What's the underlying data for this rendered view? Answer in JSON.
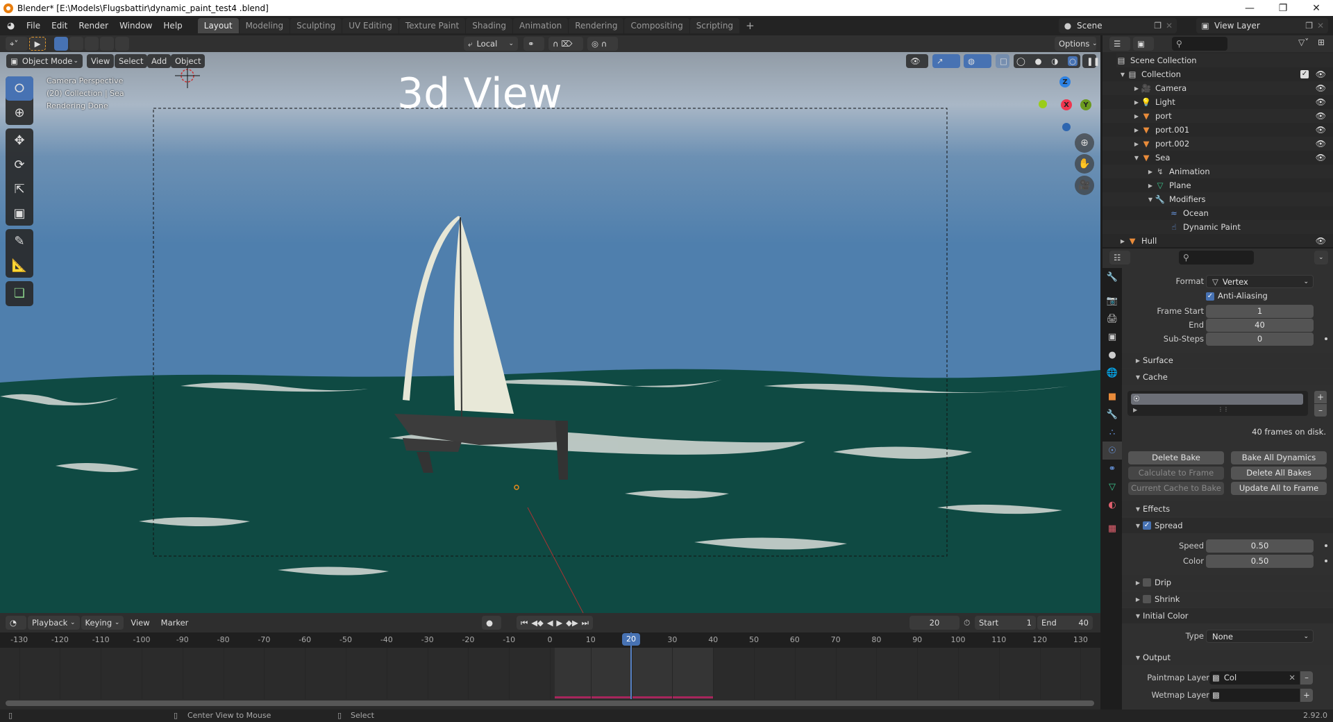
{
  "window": {
    "title": "Blender* [E:\\Models\\Flugsbattir\\dynamic_paint_test4 .blend]",
    "controls": [
      "minimize",
      "maximize",
      "close"
    ]
  },
  "menubar": {
    "menus": [
      "File",
      "Edit",
      "Render",
      "Window",
      "Help"
    ],
    "workspaces": [
      "Layout",
      "Modeling",
      "Sculpting",
      "UV Editing",
      "Texture Paint",
      "Shading",
      "Animation",
      "Rendering",
      "Compositing",
      "Scripting"
    ],
    "active_workspace": "Layout",
    "add_workspace": "+",
    "scene": "Scene",
    "view_layer": "View Layer"
  },
  "viewport": {
    "mode": "Object Mode",
    "menus": [
      "View",
      "Select",
      "Add",
      "Object"
    ],
    "transform_orientation": "Local",
    "options_label": "Options",
    "info_lines": [
      "Camera Perspective",
      "(20) Collection | Sea",
      "Rendering Done"
    ],
    "overlay_title": "3d View",
    "gizmo_axes": {
      "z": "Z",
      "x": "X",
      "y": "Y"
    },
    "colors": {
      "sky": "#5b84ad",
      "sea": "#0d4841",
      "sail": "#e8e8d8",
      "hull": "#3a3a3a",
      "axis_x": "#f0364f",
      "axis_y": "#6b9a1f",
      "axis_z": "#2f83e3"
    }
  },
  "timeline": {
    "menus": [
      "Playback",
      "Keying",
      "View",
      "Marker"
    ],
    "current_frame": "20",
    "start_label": "Start",
    "start": "1",
    "end_label": "End",
    "end": "40",
    "ruler": [
      "-130",
      "-120",
      "-110",
      "-100",
      "-90",
      "-80",
      "-70",
      "-60",
      "-50",
      "-40",
      "-30",
      "-20",
      "-10",
      "0",
      "10",
      "20",
      "30",
      "40",
      "50",
      "60",
      "70",
      "80",
      "90",
      "100",
      "110",
      "120",
      "130"
    ]
  },
  "statusbar": {
    "left_hint": "Center View to Mouse",
    "right_hint": "Select",
    "version": "2.92.0"
  },
  "outliner": {
    "root": "Scene Collection",
    "items": [
      {
        "label": "Collection",
        "depth": 0,
        "expanded": true,
        "type": "collection"
      },
      {
        "label": "Camera",
        "depth": 1,
        "expanded": false,
        "type": "camera"
      },
      {
        "label": "Light",
        "depth": 1,
        "expanded": false,
        "type": "light"
      },
      {
        "label": "port",
        "depth": 1,
        "expanded": false,
        "type": "mesh"
      },
      {
        "label": "port.001",
        "depth": 1,
        "expanded": false,
        "type": "mesh"
      },
      {
        "label": "port.002",
        "depth": 1,
        "expanded": false,
        "type": "mesh"
      },
      {
        "label": "Sea",
        "depth": 1,
        "expanded": true,
        "type": "mesh"
      },
      {
        "label": "Animation",
        "depth": 2,
        "expanded": false,
        "type": "animation"
      },
      {
        "label": "Plane",
        "depth": 2,
        "expanded": false,
        "type": "mesh-data"
      },
      {
        "label": "Modifiers",
        "depth": 2,
        "expanded": true,
        "type": "modifiers"
      },
      {
        "label": "Ocean",
        "depth": 3,
        "type": "ocean-modifier"
      },
      {
        "label": "Dynamic Paint",
        "depth": 3,
        "type": "dynamic-paint-modifier"
      },
      {
        "label": "Hull",
        "depth": 0,
        "expanded": false,
        "type": "mesh"
      }
    ]
  },
  "properties": {
    "format_label": "Format",
    "format_value": "Vertex",
    "anti_aliasing": "Anti-Aliasing",
    "frame_start_label": "Frame Start",
    "frame_start": "1",
    "end_label": "End",
    "end": "40",
    "substeps_label": "Sub-Steps",
    "substeps": "0",
    "sections": {
      "surface": "Surface",
      "cache": "Cache",
      "effects": "Effects",
      "spread": "Spread",
      "drip": "Drip",
      "shrink": "Shrink",
      "initial_color": "Initial Color",
      "output": "Output"
    },
    "cache_info": "40 frames on disk.",
    "buttons": {
      "delete_bake": "Delete Bake",
      "bake_all": "Bake All Dynamics",
      "calc_to_frame": "Calculate to Frame",
      "delete_all": "Delete All Bakes",
      "current_to_bake": "Current Cache to Bake",
      "update_all": "Update All to Frame"
    },
    "speed_label": "Speed",
    "speed": "0.50",
    "color_label": "Color",
    "color": "0.50",
    "type_label": "Type",
    "type_value": "None",
    "paintmap_label": "Paintmap Layer",
    "paintmap_value": "Col",
    "wetmap_label": "Wetmap Layer",
    "wetmap_value": ""
  }
}
